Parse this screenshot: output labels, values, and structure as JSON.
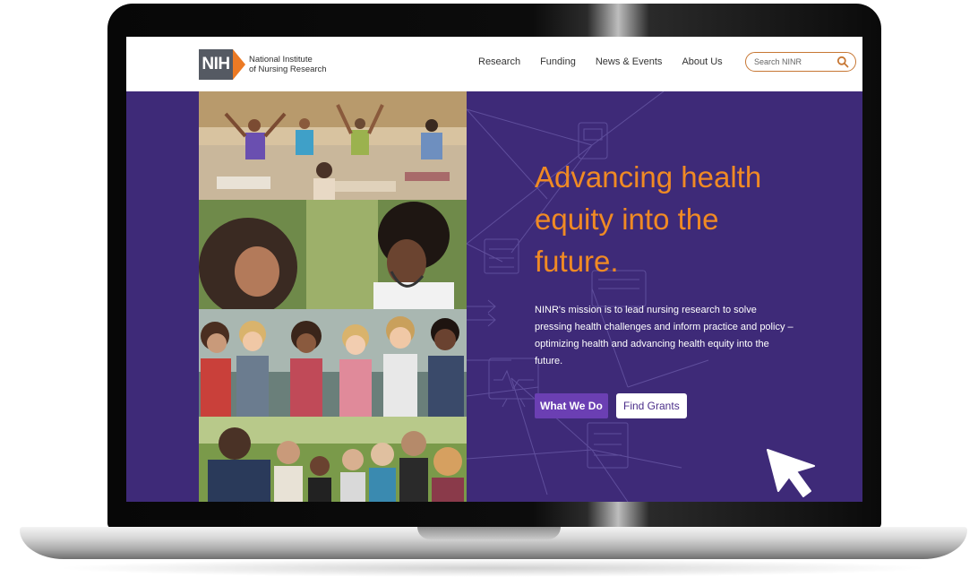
{
  "header": {
    "logo": {
      "mark": "NIH",
      "line1": "National Institute",
      "line2": "of Nursing Research"
    },
    "nav": [
      {
        "label": "Research"
      },
      {
        "label": "Funding"
      },
      {
        "label": "News & Events"
      },
      {
        "label": "About Us"
      }
    ],
    "search": {
      "placeholder": "Search NINR"
    }
  },
  "hero": {
    "headline": "Advancing health equity into the future.",
    "mission": "NINR's mission is to lead nursing research to solve pressing health challenges and inform practice and policy – optimizing health and advancing health equity into the future.",
    "primary_button": "What We Do",
    "secondary_button": "Find Grants"
  },
  "colors": {
    "hero_background": "#3e2a78",
    "headline_accent": "#f08a24",
    "primary_button": "#6b3fb3",
    "logo_orange": "#ec7a24"
  },
  "icons": [
    "search-icon",
    "mouse-pointer-icon"
  ]
}
